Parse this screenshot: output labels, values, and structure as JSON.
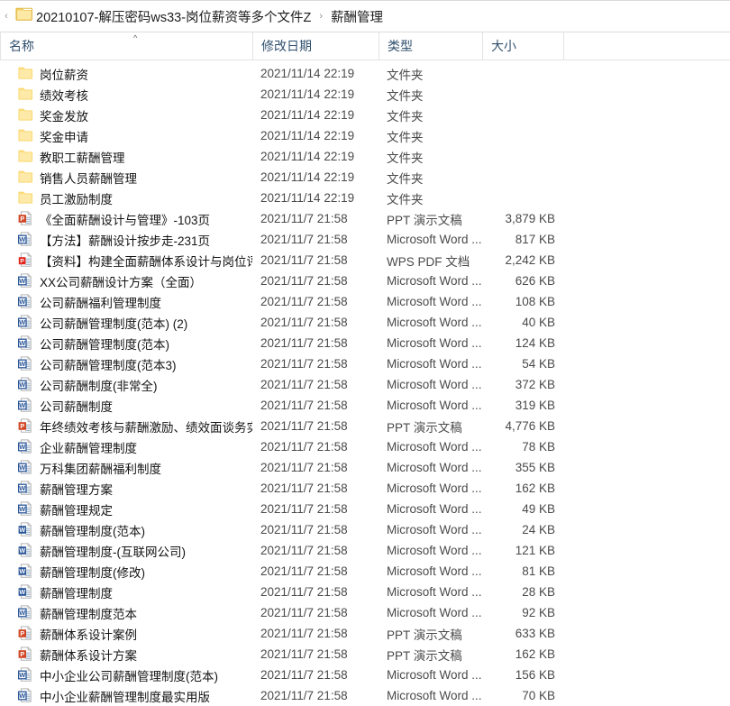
{
  "window": {
    "type": "file-explorer",
    "back_caret": "‹"
  },
  "breadcrumb": {
    "folder_icon": "folder-icon",
    "separator": "›",
    "items": [
      {
        "label": "20210107-解压密码ws33-岗位薪资等多个文件Z"
      },
      {
        "label": "薪酬管理"
      }
    ]
  },
  "columns": {
    "name": "名称",
    "date_modified": "修改日期",
    "type": "类型",
    "size": "大小",
    "sort_indicator": "^",
    "sort_column": "名称",
    "sort_direction": "ascending"
  },
  "files": [
    {
      "name": "岗位薪资",
      "date": "2021/11/14 22:19",
      "type": "文件夹",
      "size": "",
      "icon": "folder-icon"
    },
    {
      "name": "绩效考核",
      "date": "2021/11/14 22:19",
      "type": "文件夹",
      "size": "",
      "icon": "folder-icon"
    },
    {
      "name": "奖金发放",
      "date": "2021/11/14 22:19",
      "type": "文件夹",
      "size": "",
      "icon": "folder-icon"
    },
    {
      "name": "奖金申请",
      "date": "2021/11/14 22:19",
      "type": "文件夹",
      "size": "",
      "icon": "folder-icon"
    },
    {
      "name": "教职工薪酬管理",
      "date": "2021/11/14 22:19",
      "type": "文件夹",
      "size": "",
      "icon": "folder-icon"
    },
    {
      "name": "销售人员薪酬管理",
      "date": "2021/11/14 22:19",
      "type": "文件夹",
      "size": "",
      "icon": "folder-icon"
    },
    {
      "name": "员工激励制度",
      "date": "2021/11/14 22:19",
      "type": "文件夹",
      "size": "",
      "icon": "folder-icon"
    },
    {
      "name": "《全面薪酬设计与管理》-103页",
      "date": "2021/11/7 21:58",
      "type": "PPT 演示文稿",
      "size": "3,879 KB",
      "icon": "powerpoint-doc-icon"
    },
    {
      "name": "【方法】薪酬设计按步走-231页",
      "date": "2021/11/7 21:58",
      "type": "Microsoft Word ...",
      "size": "817 KB",
      "icon": "word-doc-icon"
    },
    {
      "name": "【资料】构建全面薪酬体系设计与岗位评...",
      "date": "2021/11/7 21:58",
      "type": "WPS PDF 文档",
      "size": "2,242 KB",
      "icon": "pdf-doc-icon"
    },
    {
      "name": "XX公司薪酬设计方案（全面）",
      "date": "2021/11/7 21:58",
      "type": "Microsoft Word ...",
      "size": "626 KB",
      "icon": "word-doc-icon"
    },
    {
      "name": "公司薪酬福利管理制度",
      "date": "2021/11/7 21:58",
      "type": "Microsoft Word ...",
      "size": "108 KB",
      "icon": "word-doc-icon"
    },
    {
      "name": "公司薪酬管理制度(范本) (2)",
      "date": "2021/11/7 21:58",
      "type": "Microsoft Word ...",
      "size": "40 KB",
      "icon": "word-doc-icon"
    },
    {
      "name": "公司薪酬管理制度(范本)",
      "date": "2021/11/7 21:58",
      "type": "Microsoft Word ...",
      "size": "124 KB",
      "icon": "word-doc-icon"
    },
    {
      "name": "公司薪酬管理制度(范本3)",
      "date": "2021/11/7 21:58",
      "type": "Microsoft Word ...",
      "size": "54 KB",
      "icon": "word-doc-icon"
    },
    {
      "name": "公司薪酬制度(非常全)",
      "date": "2021/11/7 21:58",
      "type": "Microsoft Word ...",
      "size": "372 KB",
      "icon": "word-doc-icon"
    },
    {
      "name": "公司薪酬制度",
      "date": "2021/11/7 21:58",
      "type": "Microsoft Word ...",
      "size": "319 KB",
      "icon": "word-doc-icon"
    },
    {
      "name": "年终绩效考核与薪酬激励、绩效面谈务实",
      "date": "2021/11/7 21:58",
      "type": "PPT 演示文稿",
      "size": "4,776 KB",
      "icon": "powerpoint-doc-icon"
    },
    {
      "name": "企业薪酬管理制度",
      "date": "2021/11/7 21:58",
      "type": "Microsoft Word ...",
      "size": "78 KB",
      "icon": "word-doc-icon"
    },
    {
      "name": "万科集团薪酬福利制度",
      "date": "2021/11/7 21:58",
      "type": "Microsoft Word ...",
      "size": "355 KB",
      "icon": "word-doc-icon"
    },
    {
      "name": "薪酬管理方案",
      "date": "2021/11/7 21:58",
      "type": "Microsoft Word ...",
      "size": "162 KB",
      "icon": "word-doc-icon"
    },
    {
      "name": "薪酬管理规定",
      "date": "2021/11/7 21:58",
      "type": "Microsoft Word ...",
      "size": "49 KB",
      "icon": "word-doc-icon"
    },
    {
      "name": "薪酬管理制度(范本)",
      "date": "2021/11/7 21:58",
      "type": "Microsoft Word ...",
      "size": "24 KB",
      "icon": "word-solid-icon"
    },
    {
      "name": "薪酬管理制度-(互联网公司)",
      "date": "2021/11/7 21:58",
      "type": "Microsoft Word ...",
      "size": "121 KB",
      "icon": "word-solid-icon"
    },
    {
      "name": "薪酬管理制度(修改)",
      "date": "2021/11/7 21:58",
      "type": "Microsoft Word ...",
      "size": "81 KB",
      "icon": "word-solid-icon"
    },
    {
      "name": "薪酬管理制度",
      "date": "2021/11/7 21:58",
      "type": "Microsoft Word ...",
      "size": "28 KB",
      "icon": "word-solid-icon"
    },
    {
      "name": "薪酬管理制度范本",
      "date": "2021/11/7 21:58",
      "type": "Microsoft Word ...",
      "size": "92 KB",
      "icon": "word-doc-icon"
    },
    {
      "name": "薪酬体系设计案例",
      "date": "2021/11/7 21:58",
      "type": "PPT 演示文稿",
      "size": "633 KB",
      "icon": "powerpoint-doc-icon"
    },
    {
      "name": "薪酬体系设计方案",
      "date": "2021/11/7 21:58",
      "type": "PPT 演示文稿",
      "size": "162 KB",
      "icon": "powerpoint-doc-icon"
    },
    {
      "name": "中小企业公司薪酬管理制度(范本)",
      "date": "2021/11/7 21:58",
      "type": "Microsoft Word ...",
      "size": "156 KB",
      "icon": "word-doc-icon"
    },
    {
      "name": "中小企业薪酬管理制度最实用版",
      "date": "2021/11/7 21:58",
      "type": "Microsoft Word ...",
      "size": "70 KB",
      "icon": "word-doc-icon"
    }
  ],
  "colors": {
    "folder_fill": "#fbd977",
    "folder_light": "#fdeaa8",
    "word_blue": "#2a5699",
    "powerpoint_orange": "#d24726",
    "pdf_red": "#e2231a",
    "header_text": "#30506e",
    "row_text": "#141414",
    "secondary_text": "#4a4a4a"
  }
}
